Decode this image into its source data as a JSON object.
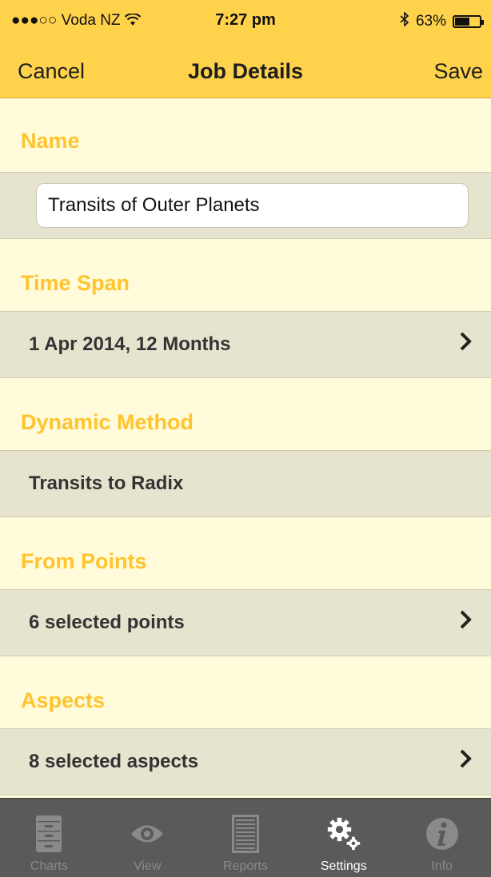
{
  "status_bar": {
    "carrier": "●●●○○ Voda NZ",
    "time": "7:27 pm",
    "battery": "63%",
    "battery_level": 0.63
  },
  "nav": {
    "cancel": "Cancel",
    "title": "Job Details",
    "save": "Save"
  },
  "sections": {
    "name": {
      "header": "Name",
      "value": "Transits of Outer Planets"
    },
    "time_span": {
      "header": "Time Span",
      "value": "1 Apr 2014, 12 Months"
    },
    "dynamic_method": {
      "header": "Dynamic Method",
      "value": "Transits to Radix"
    },
    "from_points": {
      "header": "From Points",
      "value": "6 selected points"
    },
    "aspects": {
      "header": "Aspects",
      "value": "8 selected aspects"
    }
  },
  "tabs": [
    {
      "label": "Charts",
      "icon": "cabinet-icon",
      "active": false
    },
    {
      "label": "View",
      "icon": "eye-icon",
      "active": false
    },
    {
      "label": "Reports",
      "icon": "document-icon",
      "active": false
    },
    {
      "label": "Settings",
      "icon": "gears-icon",
      "active": true
    },
    {
      "label": "Info",
      "icon": "info-icon",
      "active": false
    }
  ],
  "colors": {
    "accent": "#FFD24C",
    "section_header": "#FFC42E",
    "background": "#FFFBDB",
    "row": "#E6E4CF",
    "tab_bar": "#5a5a5a"
  }
}
